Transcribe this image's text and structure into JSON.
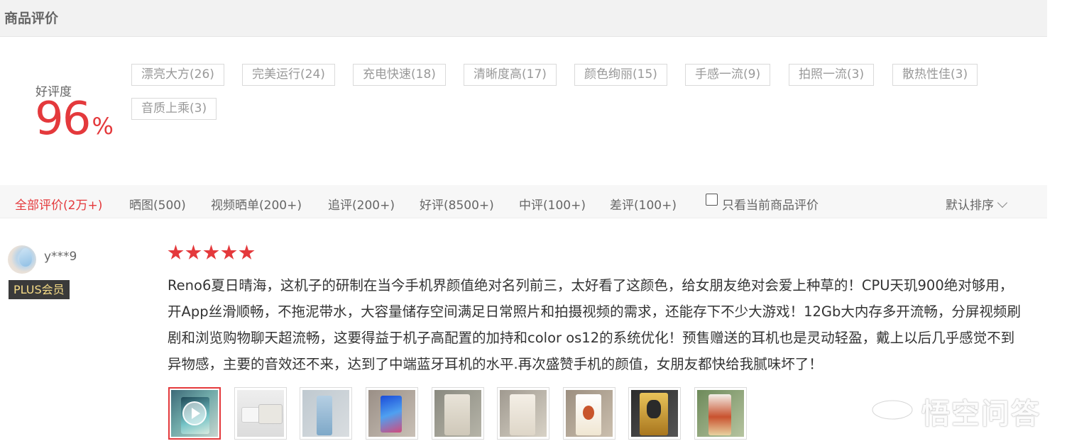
{
  "header": {
    "title": "商品评价"
  },
  "rating": {
    "label": "好评度",
    "value": "96",
    "unit": "%"
  },
  "tags": [
    "漂亮大方(26)",
    "完美运行(24)",
    "充电快速(18)",
    "清晰度高(17)",
    "颜色绚丽(15)",
    "手感一流(9)",
    "拍照一流(3)",
    "散热性佳(3)",
    "音质上乘(3)"
  ],
  "filter_tabs": [
    "全部评价(2万+)",
    "晒图(500)",
    "视频晒单(200+)",
    "追评(200+)",
    "好评(8500+)",
    "中评(100+)",
    "差评(100+)"
  ],
  "only_current": {
    "label": "只看当前商品评价",
    "checked": false
  },
  "sort": {
    "label": "默认排序"
  },
  "review": {
    "username": "y***9",
    "badge": "PLUS会员",
    "stars": 5,
    "text": "Reno6夏日晴海，这机子的研制在当今手机界颜值绝对名列前三，太好看了这颜色，给女朋友绝对会爱上种草的！CPU天玑900绝对够用，开App丝滑顺畅，不拖泥带水，大容量储存空间满足日常照片和拍摄视频的需求，还能存下不少大游戏！12Gb大内存多开流畅，分屏视频刷剧和浏览购物聊天超流畅，这要得益于机子高配置的加持和color os12的系统优化！预售赠送的耳机也是灵动轻盈，戴上以后几乎感觉不到异物感，主要的音效还不来，达到了中端蓝牙耳机的水平.再次盛赞手机的颜值，女朋友都快给我腻味坏了！",
    "thumbnails": [
      "video",
      "image",
      "image",
      "image",
      "image",
      "image",
      "image",
      "image",
      "image"
    ]
  },
  "watermark": {
    "text": "悟空问答"
  },
  "colors": {
    "accent": "#e4393c",
    "badge_bg": "#3a3a3a",
    "badge_text": "#f6dc87"
  }
}
